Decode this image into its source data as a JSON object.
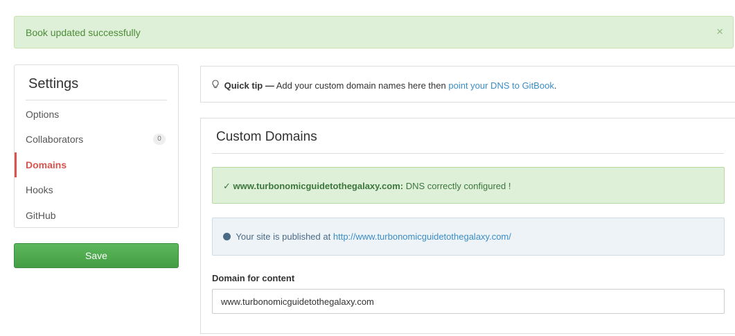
{
  "flash": {
    "message": "Book updated successfully",
    "close_glyph": "×"
  },
  "sidebar": {
    "title": "Settings",
    "items": [
      {
        "label": "Options"
      },
      {
        "label": "Collaborators",
        "badge": "0"
      },
      {
        "label": "Domains",
        "active": true
      },
      {
        "label": "Hooks"
      },
      {
        "label": "GitHub"
      }
    ],
    "save_label": "Save"
  },
  "tip": {
    "icon": "lightbulb-icon",
    "bulb_glyph": "♀",
    "bold": "Quick tip —",
    "text": "Add your custom domain names here then",
    "link": "point your DNS to GitBook",
    "end": "."
  },
  "panel": {
    "title": "Custom Domains",
    "ok_alert": {
      "check": "✓",
      "host": "www.turbonomicguidetothegalaxy.com:",
      "text": "DNS correctly configured !"
    },
    "info_alert": {
      "icon": "globe-icon",
      "text": "Your site is published at",
      "link": "http://www.turbonomicguidetothegalaxy.com/"
    },
    "domain_label": "Domain for content",
    "domain_value": "www.turbonomicguidetothegalaxy.com"
  },
  "colors": {
    "accent_red": "#d9534f",
    "success_green": "#5cb85c",
    "link_blue": "#3b8dc4"
  }
}
